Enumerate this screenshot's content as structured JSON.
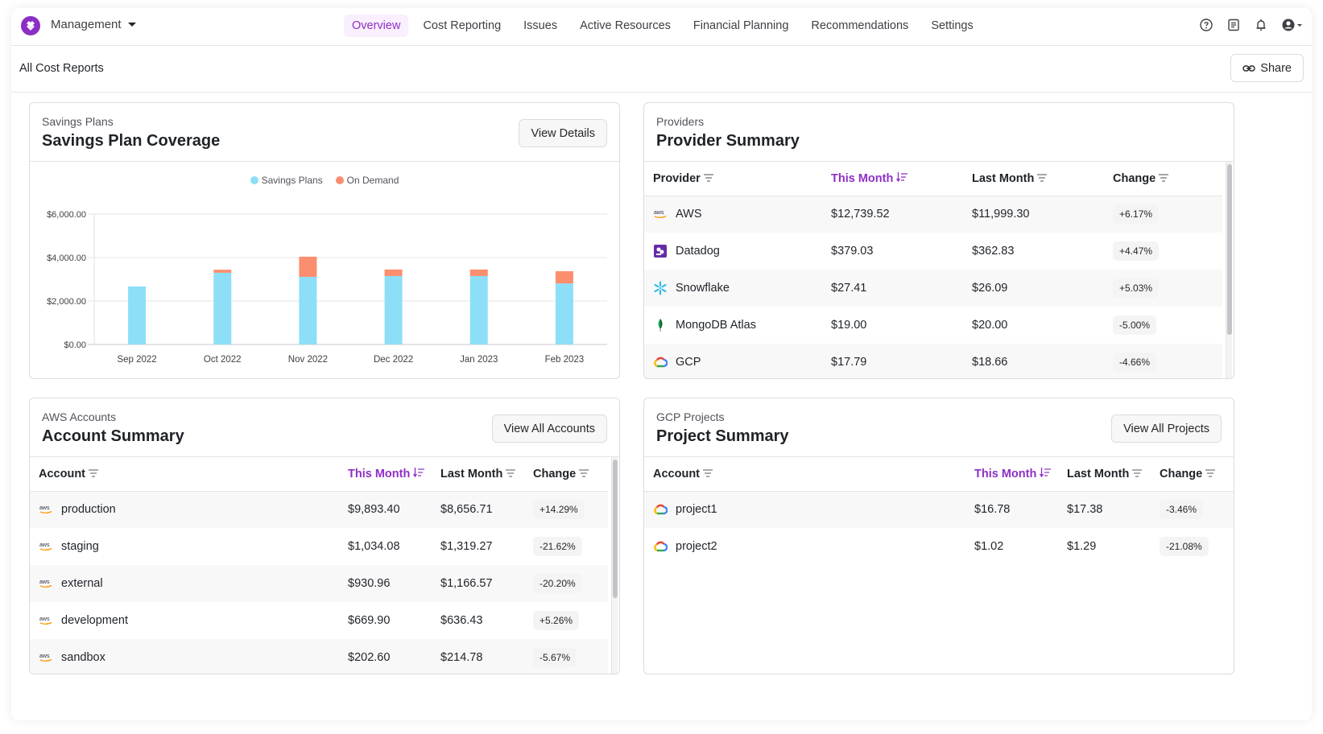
{
  "header": {
    "org_name": "Management",
    "nav": [
      {
        "label": "Overview",
        "active": true
      },
      {
        "label": "Cost Reporting",
        "active": false
      },
      {
        "label": "Issues",
        "active": false
      },
      {
        "label": "Active Resources",
        "active": false
      },
      {
        "label": "Financial Planning",
        "active": false
      },
      {
        "label": "Recommendations",
        "active": false
      },
      {
        "label": "Settings",
        "active": false
      }
    ],
    "icons": [
      "help-icon",
      "docs-icon",
      "bell-icon",
      "user-icon"
    ]
  },
  "subbar": {
    "title": "All Cost Reports",
    "share_label": "Share"
  },
  "savings": {
    "subtitle": "Savings Plans",
    "title": "Savings Plan Coverage",
    "button": "View Details"
  },
  "chart_data": {
    "type": "bar",
    "stacked": true,
    "title": "Savings Plan Coverage",
    "categories": [
      "Sep 2022",
      "Oct 2022",
      "Nov 2022",
      "Dec 2022",
      "Jan 2023",
      "Feb 2023"
    ],
    "series": [
      {
        "name": "Savings Plans",
        "color": "#8ddff7",
        "values": [
          2670,
          3300,
          3110,
          3150,
          3150,
          2810
        ]
      },
      {
        "name": "On Demand",
        "color": "#fb8e6e",
        "values": [
          0,
          140,
          930,
          300,
          300,
          560
        ]
      }
    ],
    "y_ticks": [
      "$0.00",
      "$2,000.00",
      "$4,000.00",
      "$6,000.00"
    ],
    "ylim": [
      0,
      6000
    ],
    "xlabel": "",
    "ylabel": "",
    "grid": true,
    "legend": "top-center"
  },
  "providers": {
    "subtitle": "Providers",
    "title": "Provider Summary",
    "columns": [
      "Provider",
      "This Month",
      "Last Month",
      "Change"
    ],
    "sorted_column": "This Month",
    "rows": [
      {
        "icon": "aws-icon",
        "name": "AWS",
        "this_month": "$12,739.52",
        "last_month": "$11,999.30",
        "change": "+6.17%"
      },
      {
        "icon": "datadog-icon",
        "name": "Datadog",
        "this_month": "$379.03",
        "last_month": "$362.83",
        "change": "+4.47%"
      },
      {
        "icon": "snowflake-icon",
        "name": "Snowflake",
        "this_month": "$27.41",
        "last_month": "$26.09",
        "change": "+5.03%"
      },
      {
        "icon": "mongodb-icon",
        "name": "MongoDB Atlas",
        "this_month": "$19.00",
        "last_month": "$20.00",
        "change": "-5.00%"
      },
      {
        "icon": "gcp-icon",
        "name": "GCP",
        "this_month": "$17.79",
        "last_month": "$18.66",
        "change": "-4.66%"
      }
    ]
  },
  "accounts": {
    "subtitle": "AWS Accounts",
    "title": "Account Summary",
    "button": "View All Accounts",
    "columns": [
      "Account",
      "This Month",
      "Last Month",
      "Change"
    ],
    "sorted_column": "This Month",
    "rows": [
      {
        "name": "production",
        "this_month": "$9,893.40",
        "last_month": "$8,656.71",
        "change": "+14.29%"
      },
      {
        "name": "staging",
        "this_month": "$1,034.08",
        "last_month": "$1,319.27",
        "change": "-21.62%"
      },
      {
        "name": "external",
        "this_month": "$930.96",
        "last_month": "$1,166.57",
        "change": "-20.20%"
      },
      {
        "name": "development",
        "this_month": "$669.90",
        "last_month": "$636.43",
        "change": "+5.26%"
      },
      {
        "name": "sandbox",
        "this_month": "$202.60",
        "last_month": "$214.78",
        "change": "-5.67%"
      }
    ]
  },
  "projects": {
    "subtitle": "GCP Projects",
    "title": "Project Summary",
    "button": "View All Projects",
    "columns": [
      "Account",
      "This Month",
      "Last Month",
      "Change"
    ],
    "sorted_column": "This Month",
    "rows": [
      {
        "name": "project1",
        "this_month": "$16.78",
        "last_month": "$17.38",
        "change": "-3.46%"
      },
      {
        "name": "project2",
        "this_month": "$1.02",
        "last_month": "$1.29",
        "change": "-21.08%"
      }
    ]
  }
}
